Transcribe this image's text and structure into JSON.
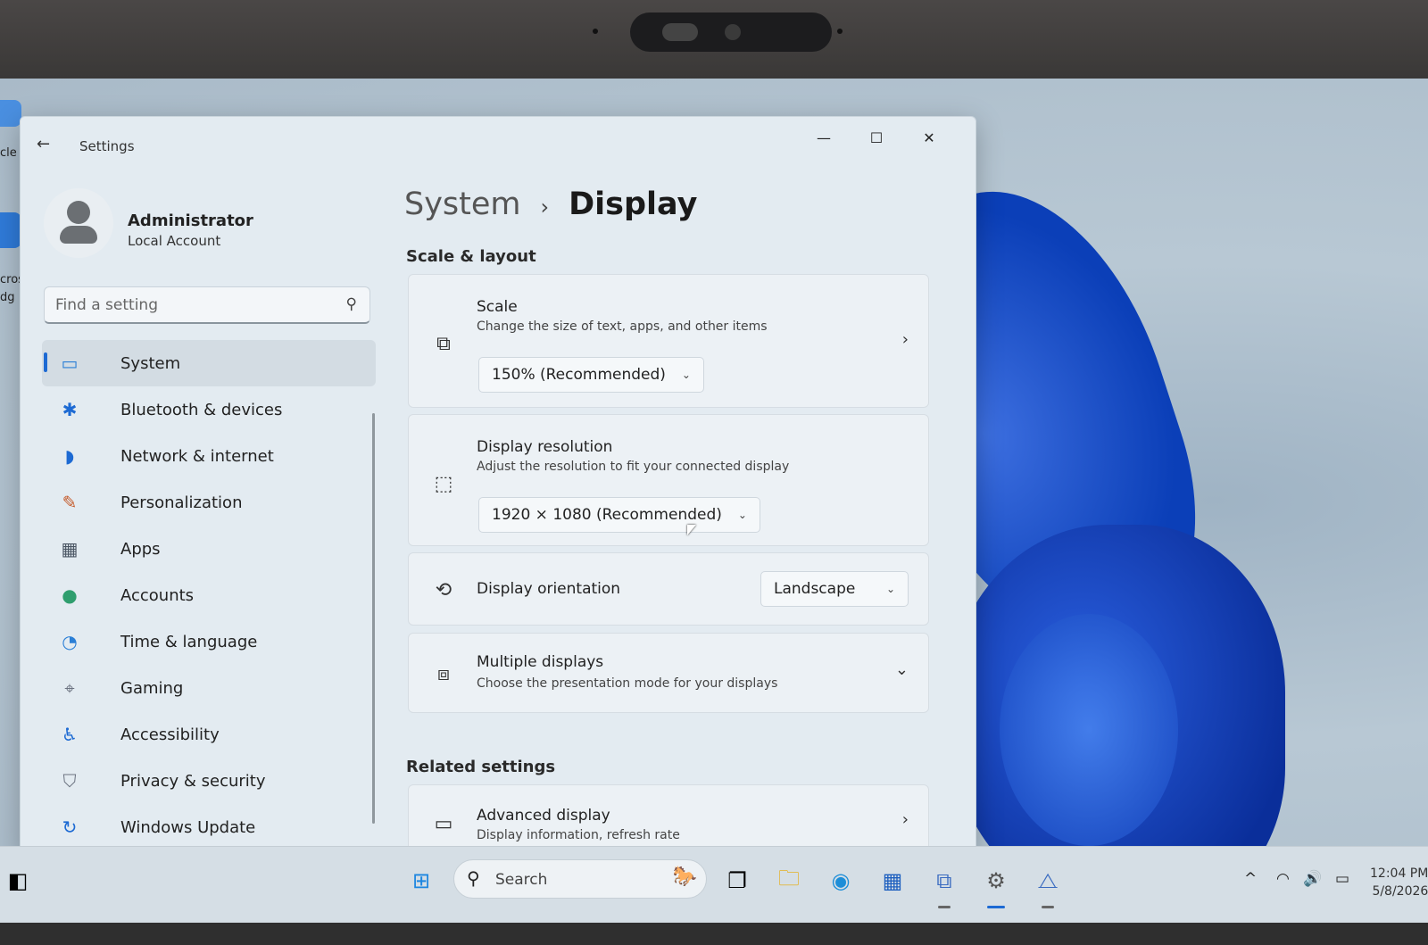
{
  "window": {
    "title": "Settings",
    "back_icon": "←",
    "minimize_icon": "—",
    "maximize_icon": "☐",
    "close_icon": "✕"
  },
  "profile": {
    "name": "Administrator",
    "account_type": "Local Account"
  },
  "search": {
    "placeholder": "Find a setting",
    "icon": "⚲"
  },
  "sidebar": {
    "items": [
      {
        "label": "System",
        "icon": "system-icon",
        "glyph": "▭",
        "color": "#2b7fd6",
        "active": true
      },
      {
        "label": "Bluetooth & devices",
        "icon": "bluetooth-icon",
        "glyph": "✱",
        "color": "#1d6ad3",
        "active": false
      },
      {
        "label": "Network & internet",
        "icon": "wifi-icon",
        "glyph": "◗",
        "color": "#1d6ad3",
        "active": false
      },
      {
        "label": "Personalization",
        "icon": "brush-icon",
        "glyph": "✎",
        "color": "#c55a2a",
        "active": false
      },
      {
        "label": "Apps",
        "icon": "apps-icon",
        "glyph": "▦",
        "color": "#4a5563",
        "active": false
      },
      {
        "label": "Accounts",
        "icon": "accounts-icon",
        "glyph": "●",
        "color": "#2f9e6e",
        "active": false
      },
      {
        "label": "Time & language",
        "icon": "globe-clock-icon",
        "glyph": "◔",
        "color": "#2b7fd6",
        "active": false
      },
      {
        "label": "Gaming",
        "icon": "gamepad-icon",
        "glyph": "⌖",
        "color": "#6b7280",
        "active": false
      },
      {
        "label": "Accessibility",
        "icon": "accessibility-icon",
        "glyph": "♿",
        "color": "#1d6ad3",
        "active": false
      },
      {
        "label": "Privacy & security",
        "icon": "shield-icon",
        "glyph": "⛉",
        "color": "#6b7280",
        "active": false
      },
      {
        "label": "Windows Update",
        "icon": "update-icon",
        "glyph": "↻",
        "color": "#1d6ad3",
        "active": false
      }
    ]
  },
  "breadcrumb": {
    "parent": "System",
    "separator": "›",
    "current": "Display"
  },
  "scale_layout": {
    "heading": "Scale & layout",
    "scale": {
      "title": "Scale",
      "description": "Change the size of text, apps, and other items",
      "value": "150% (Recommended)",
      "icon": "⧉",
      "chevron": "›",
      "caret": "⌄"
    },
    "resolution": {
      "title": "Display resolution",
      "description": "Adjust the resolution to fit your connected display",
      "value": "1920 × 1080 (Recommended)",
      "icon": "⬚",
      "caret": "⌄"
    },
    "orientation": {
      "title": "Display orientation",
      "value": "Landscape",
      "icon": "⟲",
      "caret": "⌄"
    },
    "multiple": {
      "title": "Multiple displays",
      "description": "Choose the presentation mode for your displays",
      "icon": "⧈",
      "chevron": "⌄"
    }
  },
  "related": {
    "heading": "Related settings",
    "advanced": {
      "title": "Advanced display",
      "description": "Display information, refresh rate",
      "icon": "▭",
      "chevron": "›"
    }
  },
  "taskbar": {
    "widgets_icon": "◧",
    "start_icon": "⊞",
    "search_placeholder": "Search",
    "search_icon": "⚲",
    "search_art": "🐎",
    "task_view_icon": "❐",
    "explorer_icon": "🗀",
    "edge_icon": "◉",
    "store_icon": "▦",
    "network_app_icon": "⧉",
    "settings_icon": "⚙",
    "perf_icon": "⧍",
    "tray": {
      "chevron": "^",
      "wifi": "◠",
      "volume": "🔊",
      "battery": "▭"
    },
    "time": "12:04 PM",
    "date": "5/8/2026"
  },
  "desktop": {
    "icon_label_1": "cle",
    "icon_label_2": "cros",
    "icon_label_3": "dg"
  },
  "colors": {
    "accent": "#1d6ad3",
    "window_bg": "#e3ebf1",
    "card_bg": "#ecf1f5"
  }
}
